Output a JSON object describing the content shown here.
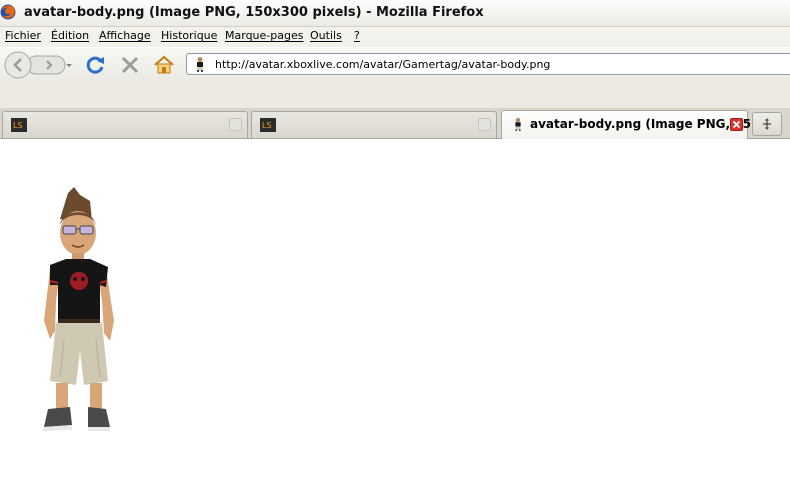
{
  "window": {
    "title": "avatar-body.png (Image PNG, 150x300 pixels) - Mozilla Firefox"
  },
  "menu": {
    "items": [
      {
        "first": "F",
        "rest": "ichier"
      },
      {
        "first": "É",
        "rest": "dition"
      },
      {
        "first": "A",
        "rest": "ffichage"
      },
      {
        "first": "H",
        "rest": "istorique"
      },
      {
        "first": "M",
        "rest": "arque-pages"
      },
      {
        "first": "O",
        "rest": "utils"
      },
      {
        "first": "?",
        "rest": ""
      }
    ]
  },
  "urlbar": {
    "value": "http://avatar.xboxlive.com/avatar/Gamertag/avatar-body.png"
  },
  "tabs": [
    {
      "label": "",
      "favicon": "ls-icon",
      "active": false
    },
    {
      "label": "",
      "favicon": "ls-icon",
      "active": false
    },
    {
      "label": "avatar-body.png (Image PNG, 15...",
      "favicon": "avatar-icon",
      "active": true
    }
  ],
  "colors": {
    "close_active": "#d8352f",
    "reload_blue": "#2a6fd1"
  }
}
